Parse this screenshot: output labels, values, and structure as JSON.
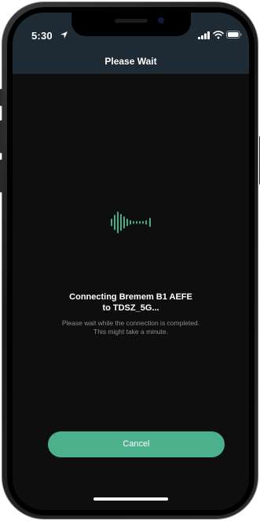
{
  "status_bar": {
    "time": "5:30"
  },
  "header": {
    "title": "Please Wait"
  },
  "main": {
    "heading_line1": "Connecting Bremem B1 AEFE",
    "heading_line2": "to TDSZ_5G...",
    "description_line1": "Please wait while the connection is completed.",
    "description_line2": "This might take a minute.",
    "cancel_label": "Cancel"
  },
  "colors": {
    "header_bg": "#1e2a34",
    "screen_bg": "#0e0e0e",
    "accent": "#4bb08c",
    "wave": "#4fd6a8"
  },
  "icons": [
    "location-arrow-icon",
    "cellular-signal-icon",
    "wifi-icon",
    "battery-icon",
    "sound-wave-icon"
  ]
}
